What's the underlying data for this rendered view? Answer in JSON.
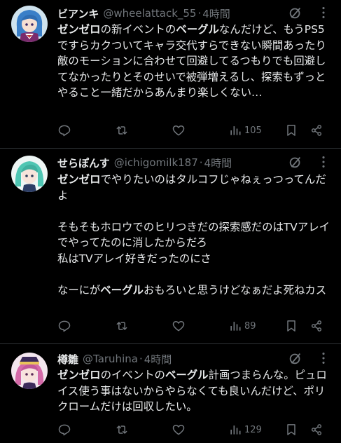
{
  "colors": {
    "background": "#000000",
    "text_primary": "#e7e9ea",
    "text_secondary": "#71767b",
    "divider": "#2f3336"
  },
  "tweets": [
    {
      "display_name": "ビアンキ",
      "handle": "@wheelattack_55",
      "separator": "·",
      "time": "4時間",
      "text_segments": [
        {
          "text": "ゼンゼロ",
          "bold": true
        },
        {
          "text": "の新イベントの",
          "bold": false
        },
        {
          "text": "ベーグル",
          "bold": true
        },
        {
          "text": "なんだけど、もうPS5ですらカクついてキャラ交代すらできない瞬間あったり敵のモーションに合わせて回避してるつもりでも回避してなかったりとそのせいで被弾増えるし、探索もずっとやること一緒だからあんまり楽しくない…",
          "bold": false
        }
      ],
      "views": "105",
      "avatar_icon": "character-avatar-blue-hair"
    },
    {
      "display_name": "せらぽんす",
      "handle": "@ichigomilk187",
      "separator": "·",
      "time": "4時間",
      "text_segments": [
        {
          "text": "ゼンゼロ",
          "bold": true
        },
        {
          "text": "でやりたいのはタルコフじゃねぇっつってんだよ\n\nそもそもホロウでのヒリつきだの探索感だのはTVアレイでやってたのに消したからだろ\n私はTVアレイ好きだったのにさ\n\nなーにが",
          "bold": false
        },
        {
          "text": "ベーグル",
          "bold": true
        },
        {
          "text": "おもろいと思うけどなぁだよ死ねカス",
          "bold": false
        }
      ],
      "views": "89",
      "avatar_icon": "character-avatar-teal-hair"
    },
    {
      "display_name": "樽雛",
      "handle": "@Taruhina",
      "separator": "·",
      "time": "4時間",
      "text_segments": [
        {
          "text": "ゼンゼロ",
          "bold": true
        },
        {
          "text": "のイベントの",
          "bold": false
        },
        {
          "text": "ベーグル",
          "bold": true
        },
        {
          "text": "計画つまらんな。ピュロイス使う事はないからやらなくても良いんだけど、ポリクロームだけは回収したい。",
          "bold": false
        }
      ],
      "views": "129",
      "avatar_icon": "character-avatar-pink-hair"
    }
  ]
}
